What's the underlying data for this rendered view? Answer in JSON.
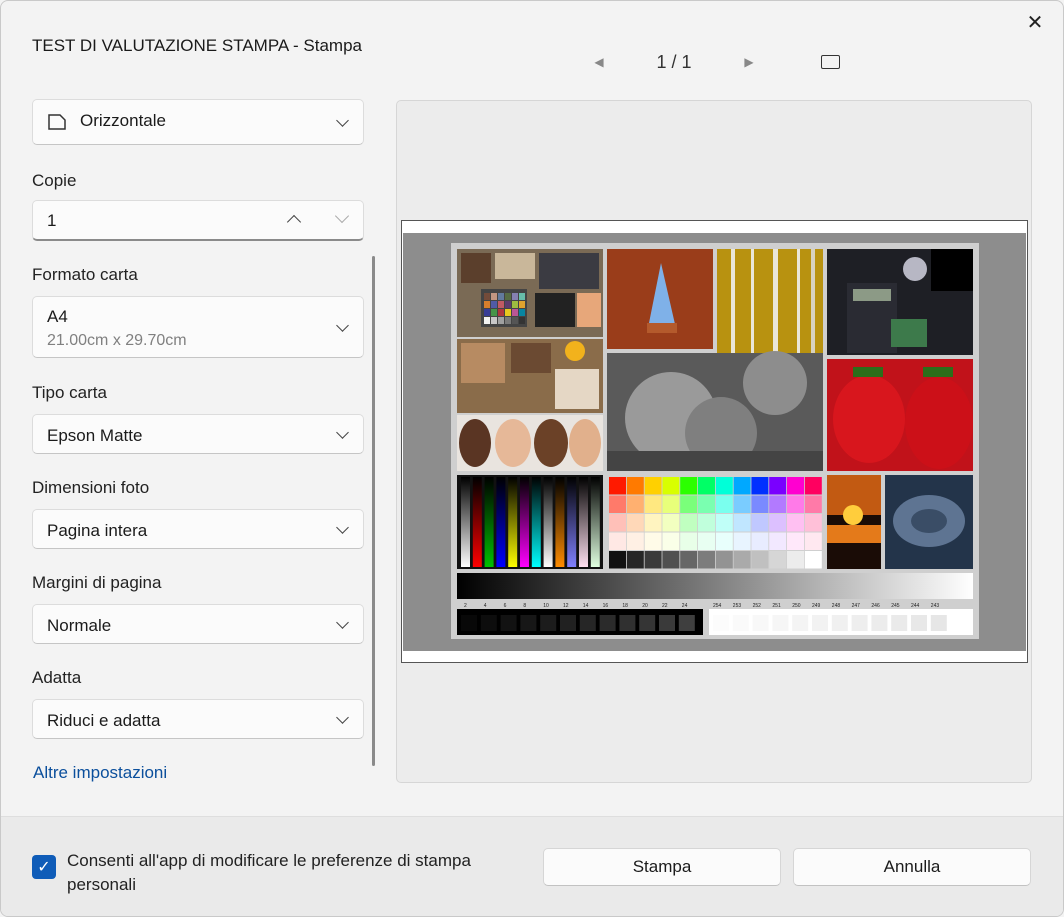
{
  "window": {
    "title": "TEST DI VALUTAZIONE STAMPA - Stampa"
  },
  "nav": {
    "page_indicator": "1 / 1"
  },
  "settings": {
    "orientation": {
      "value": "Orizzontale"
    },
    "copies": {
      "label": "Copie",
      "value": "1"
    },
    "paper_size": {
      "label": "Formato carta",
      "value": "A4",
      "sub": "21.00cm x 29.70cm"
    },
    "paper_type": {
      "label": "Tipo carta",
      "value": "Epson Matte"
    },
    "photo_size": {
      "label": "Dimensioni foto",
      "value": "Pagina intera"
    },
    "margins": {
      "label": "Margini di pagina",
      "value": "Normale"
    },
    "fit": {
      "label": "Adatta",
      "value": "Riduci e adatta"
    },
    "more_link": "Altre impostazioni"
  },
  "preview": {
    "step_labels_dark": [
      "2",
      "4",
      "6",
      "8",
      "10",
      "12",
      "14",
      "16",
      "18",
      "20",
      "22",
      "24"
    ],
    "step_labels_light": [
      "254",
      "253",
      "252",
      "251",
      "250",
      "249",
      "248",
      "247",
      "246",
      "245",
      "244",
      "243"
    ]
  },
  "footer": {
    "checkbox_label": "Consenti all'app di modificare le preferenze di stampa personali",
    "checked": true,
    "print_button": "Stampa",
    "cancel_button": "Annulla"
  },
  "colors": {
    "accent": "#0f5cb8",
    "link": "#0b4f9c"
  }
}
